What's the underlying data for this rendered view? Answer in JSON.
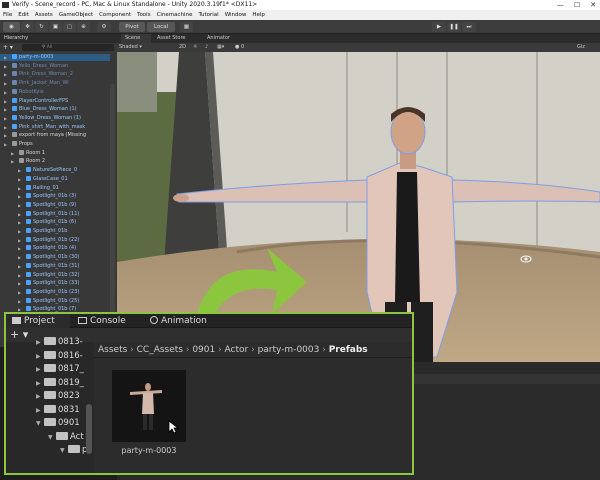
{
  "window": {
    "title": "Verify - Scene_record - PC, Mac & Linux Standalone - Unity 2020.3.19f1* <DX11>",
    "controls": [
      "—",
      "☐",
      "✕"
    ]
  },
  "menu": [
    "File",
    "Edit",
    "Assets",
    "GameObject",
    "Component",
    "Tools",
    "Cinemachine",
    "Tutorial",
    "Window",
    "Help"
  ],
  "toolbar": {
    "pivot": "Pivot",
    "local": "Local"
  },
  "hierarchy": {
    "tab": "Hierarchy",
    "search_placeholder": "All",
    "items": [
      {
        "label": "party-m-0003",
        "selected": true,
        "style": "normal",
        "depth": 0
      },
      {
        "label": "Yello_Dress_Woman",
        "style": "dim",
        "depth": 0
      },
      {
        "label": "Pink_Dress_Woman_2",
        "style": "dim",
        "depth": 0
      },
      {
        "label": "Pink_Jacket_Man_Wi",
        "style": "dim",
        "depth": 0
      },
      {
        "label": "RobotKyle",
        "style": "dim",
        "depth": 0
      },
      {
        "label": "PlayerControllerFPS",
        "style": "normal",
        "depth": 0
      },
      {
        "label": "Blue_Dress_Woman (1)",
        "style": "normal",
        "depth": 0
      },
      {
        "label": "Yellow_Dress_Woman (1)",
        "style": "normal",
        "depth": 0
      },
      {
        "label": "Pink_shirt_Man_with_mask",
        "style": "normal",
        "depth": 0
      },
      {
        "label": "export from maya (Missing",
        "style": "grey",
        "depth": 0
      },
      {
        "label": "Props",
        "style": "grey",
        "depth": 0
      },
      {
        "label": "Room 1",
        "style": "grey",
        "depth": 1
      },
      {
        "label": "Room 2",
        "style": "grey",
        "depth": 1
      },
      {
        "label": "NatureSetPiece_0",
        "style": "normal",
        "depth": 2
      },
      {
        "label": "GlassCase_01",
        "style": "normal",
        "depth": 2
      },
      {
        "label": "Railing_01",
        "style": "normal",
        "depth": 2
      },
      {
        "label": "Spotlight_01b (3)",
        "style": "normal",
        "depth": 2
      },
      {
        "label": "Spotlight_01b (9)",
        "style": "normal",
        "depth": 2
      },
      {
        "label": "Spotlight_01b (11)",
        "style": "normal",
        "depth": 2
      },
      {
        "label": "Spotlight_01b (6)",
        "style": "normal",
        "depth": 2
      },
      {
        "label": "Spotlight_01b",
        "style": "normal",
        "depth": 2
      },
      {
        "label": "Spotlight_01b (22)",
        "style": "normal",
        "depth": 2
      },
      {
        "label": "Spotlight_01b (4)",
        "style": "normal",
        "depth": 2
      },
      {
        "label": "Spotlight_01b (30)",
        "style": "normal",
        "depth": 2
      },
      {
        "label": "Spotlight_01b (31)",
        "style": "normal",
        "depth": 2
      },
      {
        "label": "Spotlight_01b (32)",
        "style": "normal",
        "depth": 2
      },
      {
        "label": "Spotlight_01b (33)",
        "style": "normal",
        "depth": 2
      },
      {
        "label": "Spotlight_01b (23)",
        "style": "normal",
        "depth": 2
      },
      {
        "label": "Spotlight_01b (25)",
        "style": "normal",
        "depth": 2
      },
      {
        "label": "Spotlight_01b (7)",
        "style": "normal",
        "depth": 2
      },
      {
        "label": "Spotlight_01b_larg",
        "style": "normal",
        "depth": 2
      },
      {
        "label": "Spotlight_01b_larg",
        "style": "normal",
        "depth": 2
      }
    ]
  },
  "scene": {
    "tabs": [
      "Scene",
      "Asset Store",
      "Animator"
    ],
    "shading_mode": "Shaded",
    "mode_2d": "2D",
    "gizmos": "Giz"
  },
  "project": {
    "tabs": [
      "Project",
      "Console",
      "Animation"
    ],
    "add_label": "+ ▾",
    "tree": [
      {
        "label": "0813-",
        "depth": 0
      },
      {
        "label": "0816-",
        "depth": 0
      },
      {
        "label": "0817_",
        "depth": 0
      },
      {
        "label": "0819_",
        "depth": 0
      },
      {
        "label": "0823",
        "depth": 0
      },
      {
        "label": "0831",
        "depth": 0
      },
      {
        "label": "0901",
        "depth": 0,
        "open": true
      },
      {
        "label": "Act",
        "depth": 1,
        "open": true
      },
      {
        "label": "p",
        "depth": 2,
        "open": true
      }
    ],
    "breadcrumb": [
      "Assets",
      "CC_Assets",
      "0901",
      "Actor",
      "party-m-0003",
      "Prefabs"
    ],
    "asset_name": "party-m-0003"
  },
  "colors": {
    "accent_green": "#8cc63f",
    "selection_blue": "#2c5d87",
    "prefab_blue": "#4aa4ff"
  }
}
